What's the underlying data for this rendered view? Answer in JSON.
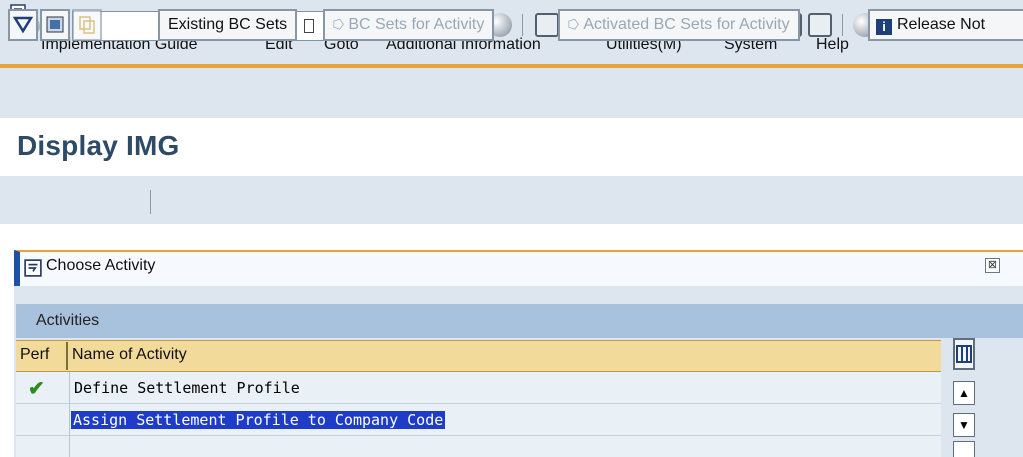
{
  "menubar": {
    "items": [
      "Implementation Guide",
      "Edit",
      "Goto",
      "Additional Information",
      "Utilities(M)",
      "System",
      "Help"
    ]
  },
  "toolbar": {
    "command_field_value": "",
    "icons": [
      "ok-icon",
      "back-icon",
      "save-icon",
      "back-nav-icon",
      "exit-icon",
      "cancel-icon",
      "print-icon",
      "find-icon",
      "find-next-icon",
      "first-page-icon",
      "prev-page-icon",
      "next-page-icon",
      "last-page-icon",
      "create-session-icon",
      "shortcut-icon",
      "help-icon",
      "layout-menu-icon"
    ]
  },
  "page": {
    "title": "Display IMG"
  },
  "app_toolbar": {
    "existing_bc_sets": "Existing BC Sets",
    "bc_sets_for_activity": "BC Sets for Activity",
    "activated_bc_sets": "Activated BC Sets for Activity",
    "release_notes": "Release Not"
  },
  "popup": {
    "title": "Choose Activity",
    "close_glyph": "⊠",
    "grid_title": "Activities",
    "columns": {
      "perf": "Perf",
      "name": "Name of Activity"
    },
    "rows": [
      {
        "perf": "✔",
        "name": "Define Settlement Profile",
        "selected": false
      },
      {
        "perf": "",
        "name": "Assign Settlement Profile to Company Code",
        "selected": true
      }
    ]
  },
  "colors": {
    "accent": "#e8a33d",
    "title": "#2d4a66",
    "selection": "#1e3cc8",
    "header": "#f2db9a"
  }
}
